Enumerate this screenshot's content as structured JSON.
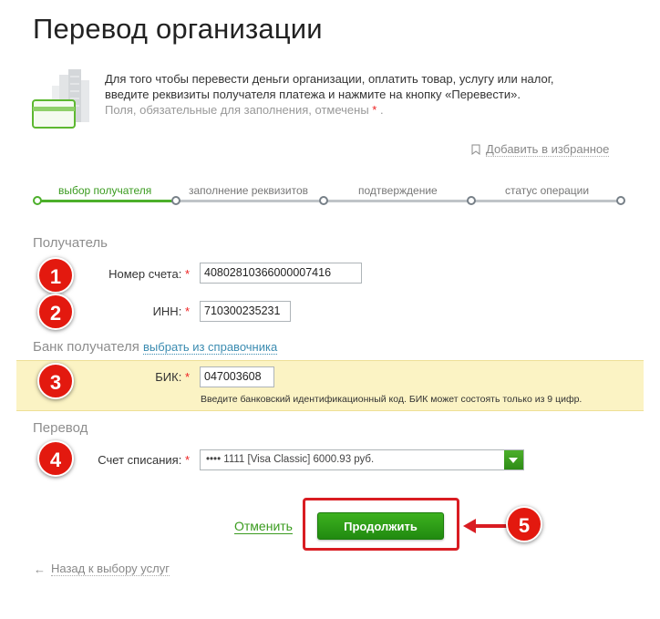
{
  "page_title": "Перевод организации",
  "intro": {
    "line1": "Для того чтобы перевести деньги организации, оплатить товар, услугу или налог,",
    "line2": "введите реквизиты получателя платежа и нажмите на кнопку «Перевести».",
    "required_note": "Поля, обязательные для заполнения, отмечены",
    "required_mark": "*",
    "required_tail": "."
  },
  "favorites_link": "Добавить в избранное",
  "steps": [
    {
      "label": "выбор получателя",
      "active": true
    },
    {
      "label": "заполнение реквизитов",
      "active": false
    },
    {
      "label": "подтверждение",
      "active": false
    },
    {
      "label": "статус операции",
      "active": false
    }
  ],
  "sections": {
    "recipient": "Получатель",
    "bank": "Банк получателя",
    "bank_link": "выбрать из справочника",
    "transfer": "Перевод"
  },
  "fields": {
    "account": {
      "label": "Номер счета:",
      "req": "*",
      "value": "40802810366000007416"
    },
    "inn": {
      "label": "ИНН:",
      "req": "*",
      "value": "710300235231"
    },
    "bik": {
      "label": "БИК:",
      "req": "*",
      "value": "047003608",
      "hint": "Введите банковский идентификационный код. БИК может состоять только из 9 цифр."
    },
    "debit_account": {
      "label": "Счет списания:",
      "req": "*",
      "value": "•••• 1111 [Visa Classic] 6000.93 руб."
    }
  },
  "badges": [
    "1",
    "2",
    "3",
    "4",
    "5"
  ],
  "actions": {
    "cancel": "Отменить",
    "continue": "Продолжить",
    "back": "Назад к выбору услуг"
  },
  "colors": {
    "accent_green": "#3a9b1f",
    "badge_red": "#e3190f",
    "highlight_yellow": "#fbf3c4"
  },
  "icons": {
    "intro": "card-building-icon",
    "favorites": "bookmark-icon",
    "back": "arrow-left-icon",
    "select": "chevron-down-icon"
  }
}
